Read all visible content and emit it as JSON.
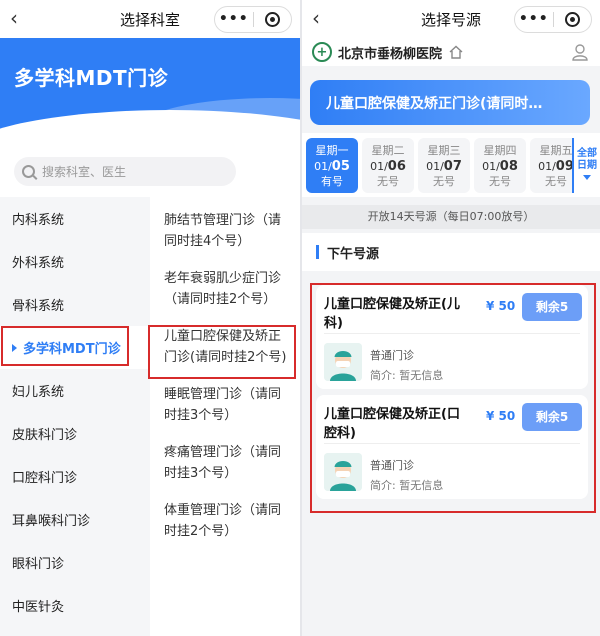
{
  "left": {
    "nav": {
      "title": "选择科室",
      "back": "‹",
      "more": "•••"
    },
    "hero": {
      "title": "多学科MDT门诊"
    },
    "search": {
      "placeholder": "搜索科室、医生"
    },
    "categories": [
      {
        "label": "内科系统",
        "active": false
      },
      {
        "label": "外科系统",
        "active": false
      },
      {
        "label": "骨科系统",
        "active": false
      },
      {
        "label": "多学科MDT门诊",
        "active": true
      },
      {
        "label": "妇儿系统",
        "active": false
      },
      {
        "label": "皮肤科门诊",
        "active": false
      },
      {
        "label": "口腔科门诊",
        "active": false
      },
      {
        "label": "耳鼻喉科门诊",
        "active": false
      },
      {
        "label": "眼科门诊",
        "active": false
      },
      {
        "label": "中医针灸",
        "active": false
      }
    ],
    "subclinics": [
      {
        "label": "肺结节管理门诊（请同时挂4个号）"
      },
      {
        "label": "老年衰弱肌少症门诊（请同时挂2个号）"
      },
      {
        "label": "儿童口腔保健及矫正门诊(请同时挂2个号)"
      },
      {
        "label": "睡眠管理门诊（请同时挂3个号）"
      },
      {
        "label": "疼痛管理门诊（请同时挂3个号）"
      },
      {
        "label": "体重管理门诊（请同时挂2个号）"
      }
    ]
  },
  "right": {
    "nav": {
      "title": "选择号源",
      "back": "‹",
      "more": "•••"
    },
    "hospital": {
      "name": "北京市垂杨柳医院"
    },
    "dept_title": "儿童口腔保健及矫正门诊(请同时…",
    "dates": [
      {
        "weekday": "星期一",
        "month": "01/",
        "day": "05",
        "status": "有号",
        "selected": true
      },
      {
        "weekday": "星期二",
        "month": "01/",
        "day": "06",
        "status": "无号",
        "selected": false
      },
      {
        "weekday": "星期三",
        "month": "01/",
        "day": "07",
        "status": "无号",
        "selected": false
      },
      {
        "weekday": "星期四",
        "month": "01/",
        "day": "08",
        "status": "无号",
        "selected": false
      },
      {
        "weekday": "星期五",
        "month": "01/",
        "day": "09",
        "status": "无号",
        "selected": false
      }
    ],
    "all_dates": {
      "line1": "全部",
      "line2": "日期"
    },
    "open_info": "开放14天号源（每日07:00放号）",
    "section": "下午号源",
    "doctors": [
      {
        "name": "儿童口腔保健及矫正(儿科)",
        "price": "¥ 50",
        "remain": "剩余5",
        "type": "普通门诊",
        "intro": "简介:  暂无信息"
      },
      {
        "name": "儿童口腔保健及矫正(口腔科)",
        "price": "¥ 50",
        "remain": "剩余5",
        "type": "普通门诊",
        "intro": "简介:  暂无信息"
      }
    ]
  },
  "colors": {
    "accent": "#2f7ef5",
    "highlight": "#d72b2b",
    "remain_button": "#6c9ef7"
  }
}
